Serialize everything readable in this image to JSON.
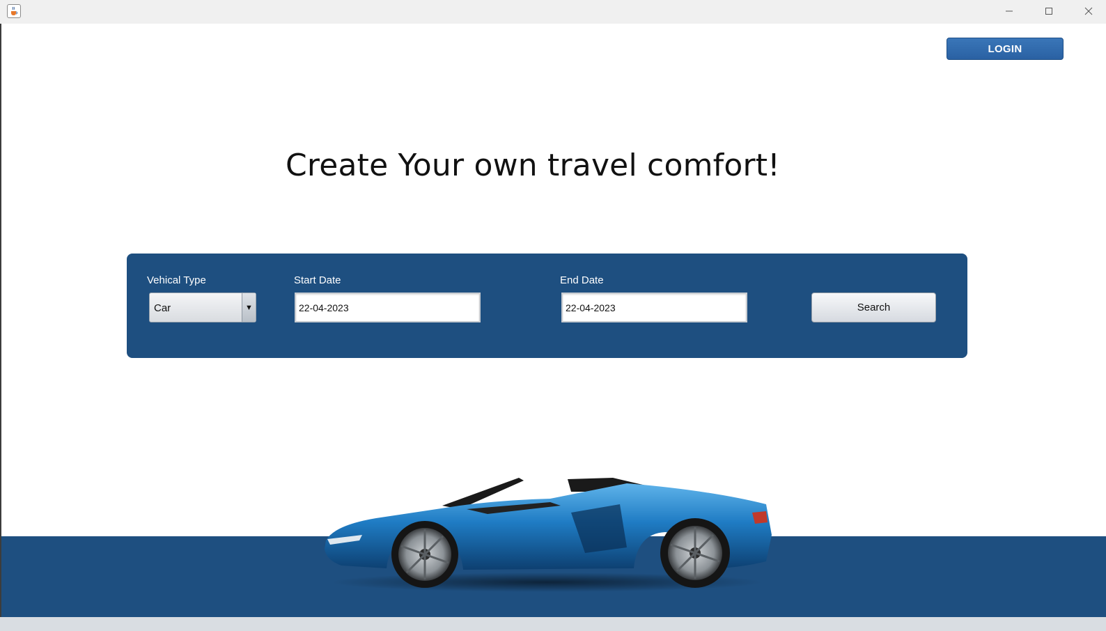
{
  "window": {
    "app_icon": "java-cup-icon",
    "controls": [
      "minimize-icon",
      "maximize-icon",
      "close-icon"
    ]
  },
  "header": {
    "login_label": "LOGIN"
  },
  "hero": {
    "headline": "Create Your own travel comfort!"
  },
  "search": {
    "vehicle_type_label": "Vehical Type",
    "vehicle_type_value": "Car",
    "start_date_label": "Start Date",
    "start_date_value": "22-04-2023",
    "end_date_label": "End Date",
    "end_date_value": "22-04-2023",
    "search_label": "Search"
  },
  "footer": {
    "image": "blue-convertible-sports-car"
  },
  "colors": {
    "brand_blue": "#1e4f80",
    "login_blue": "#2a61a3",
    "background": "#ffffff"
  }
}
